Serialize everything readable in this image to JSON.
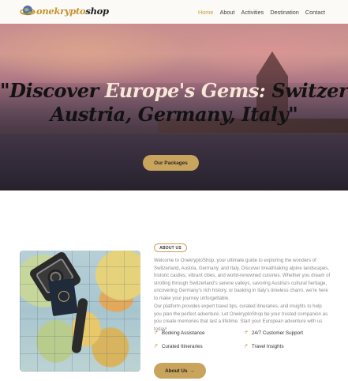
{
  "brand": {
    "part1": "onekrypto",
    "part2": "shop"
  },
  "nav": {
    "items": [
      "Home",
      "About",
      "Activities",
      "Destination",
      "Contact"
    ],
    "active": "Home"
  },
  "hero": {
    "line1_pre": "\"Discover ",
    "line1_highlight": "Europe's Gems:",
    "line1_post": " Switzerland,",
    "line2": "Austria, Germany, Italy\"",
    "button": "Our Packages"
  },
  "about": {
    "badge": "ABOUT US",
    "paragraph1": "Welcome to OnekryptoShop, your ultimate guide to exploring the wonders of Switzerland, Austria, Germany, and Italy. Discover breathtaking alpine landscapes, historic castles, vibrant cities, and world-renowned cuisines. Whether you dream of strolling through Switzerland's serene valleys, savoring Austria's cultural heritage, uncovering Germany's rich history, or basking in Italy's timeless charm, we're here to make your journey unforgettable.",
    "paragraph2": "Our platform provides expert travel tips, curated itineraries, and insights to help you plan the perfect adventure. Let OnekryptoShop be your trusted companion as you create memories that last a lifetime. Start your European adventure with us today!",
    "features": [
      "Booking Assistance",
      "24/7 Customer Support",
      "Curated Itineraries",
      "Travel Insights"
    ],
    "button": "About Us"
  },
  "icons": {
    "feature": "arrow-turn-icon",
    "button": "arrow-right-icon"
  },
  "colors": {
    "accent": "#c9a45c",
    "active_nav": "#c99b3c"
  }
}
